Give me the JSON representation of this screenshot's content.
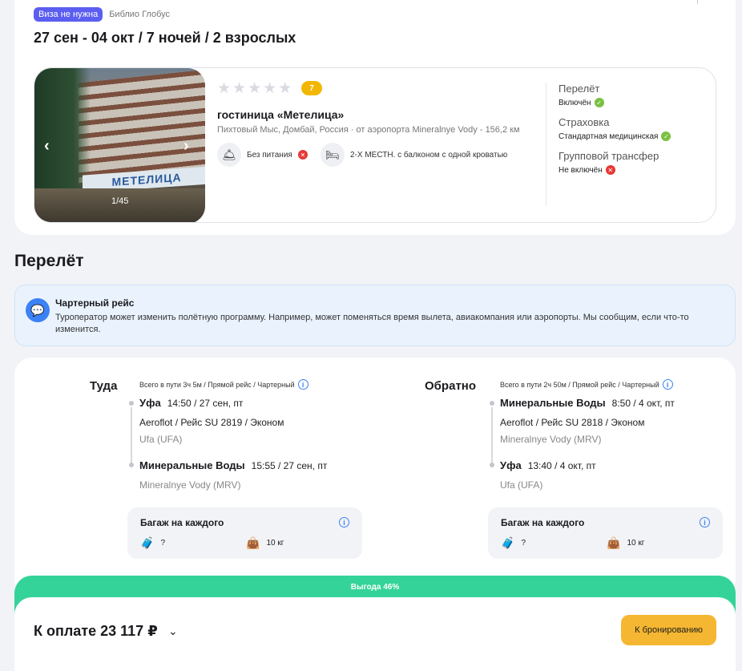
{
  "header": {
    "visa_badge": "Виза не нужна",
    "operator": "Библио Глобус",
    "dates_title": "27 сен - 04 окт / 7 ночей / 2 взрослых"
  },
  "hotel": {
    "photo_counter": "1/45",
    "photo_sign": "МЕТЕЛИЦА",
    "rating": "7",
    "stars_total": 5,
    "name": "гостиница «Метелица»",
    "location": "Пихтовый Мыс, Домбай, Россия · от аэропорта Mineralnye Vody - 156,2 км",
    "meals": "Без питания",
    "room": "2-Х МЕСТН. с балконом с одной кроватью",
    "services": [
      {
        "title": "Перелёт",
        "value": "Включён",
        "status": "ok"
      },
      {
        "title": "Страховка",
        "value": "Стандартная медицинская",
        "status": "ok"
      },
      {
        "title": "Групповой трансфер",
        "value": "Не включён",
        "status": "no"
      }
    ]
  },
  "flight_section_title": "Перелёт",
  "charter": {
    "title": "Чартерный рейс",
    "text": "Туроператор может изменить полётную программу. Например, может поменяться время вылета, авиакомпания или аэропорты. Мы сообщим, если что-то изменится."
  },
  "outbound": {
    "label": "Туда",
    "summary": "Всего в пути 3ч 5м / Прямой рейс / Чартерный",
    "from_city": "Уфа",
    "from_time": "14:50 / 27 сен, пт",
    "carrier": "Aeroflot / Рейс SU 2819 / Эконом",
    "from_code": "Ufa (UFA)",
    "to_city": "Минеральные Воды",
    "to_time": "15:55 / 27 сен, пт",
    "to_code": "Mineralnye Vody (MRV)",
    "baggage_title": "Багаж на каждого",
    "hand_luggage": "?",
    "checked_bag": "10 кг"
  },
  "return": {
    "label": "Обратно",
    "summary": "Всего в пути 2ч 50м / Прямой рейс / Чартерный",
    "from_city": "Минеральные Воды",
    "from_time": "8:50 / 4 окт, пт",
    "carrier": "Aeroflot / Рейс SU 2818 / Эконом",
    "from_code": "Mineralnye Vody (MRV)",
    "to_city": "Уфа",
    "to_time": "13:40 / 4 окт, пт",
    "to_code": "Ufa (UFA)",
    "baggage_title": "Багаж на каждого",
    "hand_luggage": "?",
    "checked_bag": "10 кг"
  },
  "promo": "Выгода 46%",
  "payment": {
    "label": "К оплате 23 117 ₽",
    "book_button": "К бронированию"
  },
  "colors": {
    "visa_badge": "#5b5ef0",
    "rating": "#f2b705",
    "promo": "#34d399",
    "book_button": "#f5b731",
    "charter_icon": "#3b82f6"
  }
}
